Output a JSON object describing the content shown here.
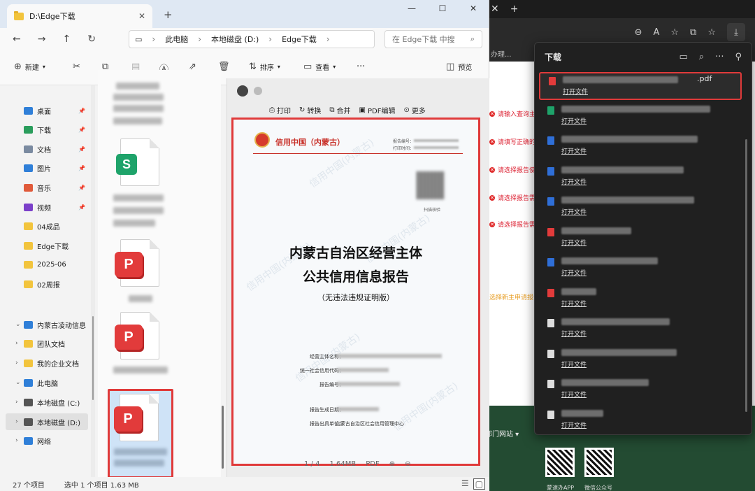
{
  "explorer": {
    "tab_title": "D:\\Edge下载",
    "tab_close": "✕",
    "new_tab": "+",
    "window": {
      "minimize": "—",
      "maximize": "☐",
      "close": "✕"
    },
    "breadcrumb": [
      "此电脑",
      "本地磁盘 (D:)",
      "Edge下载"
    ],
    "search_placeholder": "在 Edge下载 中搜",
    "commands": {
      "new": "新建",
      "sort": "排序",
      "view": "查看",
      "more": "···",
      "preview": "预览"
    },
    "sidebar": {
      "quick_access": [
        {
          "label": "桌面",
          "color": "#2f7fd8"
        },
        {
          "label": "下载",
          "color": "#2a9d5c"
        },
        {
          "label": "文档",
          "color": "#7a8aa0"
        },
        {
          "label": "图片",
          "color": "#2f7fd8"
        },
        {
          "label": "音乐",
          "color": "#e05a3a"
        },
        {
          "label": "视频",
          "color": "#7b3fc9"
        },
        {
          "label": "04成品",
          "color": "#f2c43d"
        },
        {
          "label": "Edge下载",
          "color": "#f2c43d"
        },
        {
          "label": "2025-06",
          "color": "#f2c43d"
        },
        {
          "label": "02周报",
          "color": "#f2c43d"
        }
      ],
      "tree": [
        {
          "label": "内蒙古凌动信息",
          "expanded": true
        },
        {
          "label": "团队文档"
        },
        {
          "label": "我的企业文档"
        },
        {
          "label": "此电脑",
          "expanded": true
        },
        {
          "label": "本地磁盘 (C:)"
        },
        {
          "label": "本地磁盘 (D:)",
          "selected": true
        },
        {
          "label": "网络"
        }
      ]
    },
    "status": {
      "items_count": "27 个项目",
      "selected": "选中 1 个项目  1.63 MB"
    }
  },
  "preview": {
    "toolbar": [
      "打印",
      "转换",
      "合并",
      "PDF编辑",
      "更多"
    ],
    "report": {
      "org": "信用中国（内蒙古）",
      "meta_labels": [
        "报告编号：",
        "打印时间："
      ],
      "qr_caption": "扫描核验",
      "title_line1": "内蒙古自治区经营主体",
      "title_line2": "公共信用信息报告",
      "subtitle": "（无违法违规证明版）",
      "fields": [
        "经营主体名称：",
        "统一社会信用代码：",
        "报告编号：",
        "报告生成日期：",
        "报告出具单位："
      ],
      "issuer": "内蒙古自治区社会信用管理中心",
      "watermark": "信用中国(内蒙古)"
    },
    "status": [
      "1 / 4",
      "1.64MB",
      "PDF"
    ]
  },
  "downloads": {
    "title": "下载",
    "items": [
      {
        "ext": ".pdf",
        "open": "打开文件",
        "color": "#e23b3b",
        "highlight": true,
        "name_width": 0.66
      },
      {
        "open": "打开文件",
        "color": "#1ea36a",
        "name_width": 0.85
      },
      {
        "open": "打开文件",
        "color": "#2f6fd8",
        "name_width": 0.78
      },
      {
        "open": "打开文件",
        "color": "#2f6fd8",
        "name_width": 0.7
      },
      {
        "open": "打开文件",
        "color": "#2f6fd8",
        "name_width": 0.76
      },
      {
        "open": "打开文件",
        "color": "#e23b3b",
        "name_width": 0.4
      },
      {
        "open": "打开文件",
        "color": "#2f6fd8",
        "name_width": 0.55
      },
      {
        "open": "打开文件",
        "color": "#e23b3b",
        "name_width": 0.2
      },
      {
        "open": "打开文件",
        "color": "#dddddd",
        "name_width": 0.62
      },
      {
        "open": "打开文件",
        "color": "#dddddd",
        "name_width": 0.66
      },
      {
        "open": "打开文件",
        "color": "#dddddd",
        "name_width": 0.5
      },
      {
        "open": "打开文件",
        "color": "#dddddd",
        "name_width": 0.24
      }
    ]
  },
  "browser_bg": {
    "fav_item": "办理...",
    "errors": [
      "请输入查询主",
      "请填写正确的",
      "请选择报告使",
      "请选择报告需求",
      "请选择报告需求"
    ],
    "warn_line": "选择新主申请报告",
    "footer_link": "部门网站",
    "qr_labels": [
      "蒙速办APP",
      "微信公众号"
    ]
  }
}
